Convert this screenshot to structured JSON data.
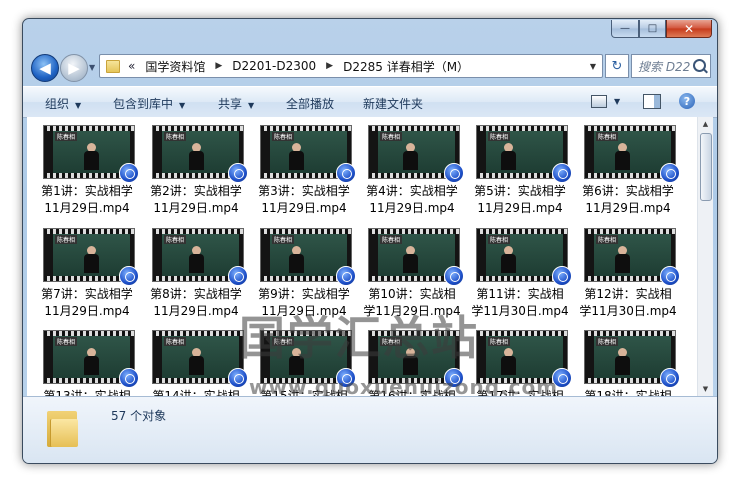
{
  "window": {
    "controls": {
      "minimize": "—",
      "maximize": "□",
      "close": "✕"
    }
  },
  "nav": {
    "back_icon": "◀",
    "forward_icon": "▶",
    "overflow": "«",
    "breadcrumbs": [
      "国学资料馆",
      "D2201-D2300",
      "D2285 详春相学（M）"
    ],
    "refresh_icon": "↻",
    "search_placeholder": "搜索 D228..."
  },
  "toolbar": {
    "organize": "组织",
    "include_in_library": "包含到库中",
    "share": "共享",
    "play_all": "全部播放",
    "new_folder": "新建文件夹",
    "help": "?"
  },
  "files": [
    {
      "line1": "第1讲：实战相学",
      "line2": "11月29日.mp4"
    },
    {
      "line1": "第2讲：实战相学",
      "line2": "11月29日.mp4"
    },
    {
      "line1": "第3讲：实战相学",
      "line2": "11月29日.mp4"
    },
    {
      "line1": "第4讲：实战相学",
      "line2": "11月29日.mp4"
    },
    {
      "line1": "第5讲：实战相学",
      "line2": "11月29日.mp4"
    },
    {
      "line1": "第6讲：实战相学",
      "line2": "11月29日.mp4"
    },
    {
      "line1": "第7讲：实战相学",
      "line2": "11月29日.mp4"
    },
    {
      "line1": "第8讲：实战相学",
      "line2": "11月29日.mp4"
    },
    {
      "line1": "第9讲：实战相学",
      "line2": "11月29日.mp4"
    },
    {
      "line1": "第10讲：实战相",
      "line2": "学11月29日.mp4"
    },
    {
      "line1": "第11讲：实战相",
      "line2": "学11月30日.mp4"
    },
    {
      "line1": "第12讲：实战相",
      "line2": "学11月30日.mp4"
    },
    {
      "line1": "第13讲：实战相",
      "line2": ""
    },
    {
      "line1": "第14讲：实战相",
      "line2": ""
    },
    {
      "line1": "第15讲：实战相",
      "line2": ""
    },
    {
      "line1": "第16讲：实战相",
      "line2": ""
    },
    {
      "line1": "第17讲：实战相",
      "line2": ""
    },
    {
      "line1": "第18讲：实战相",
      "line2": ""
    }
  ],
  "thumb_logo": "陈春相",
  "watermark": {
    "text": "国学汇总站",
    "url": "www.guoxuehuizong.com"
  },
  "status": {
    "count_text": "57 个对象"
  },
  "colors": {
    "accent": "#1e395b",
    "frame": "#b9d1ea",
    "close": "#c63a1c"
  }
}
